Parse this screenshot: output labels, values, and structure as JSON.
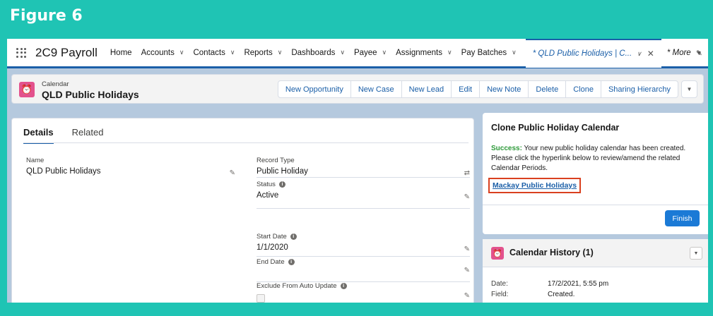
{
  "figure": {
    "title": "Figure 6"
  },
  "nav": {
    "app_name": "2C9 Payroll",
    "items": [
      {
        "label": "Home",
        "has_menu": false
      },
      {
        "label": "Accounts",
        "has_menu": true
      },
      {
        "label": "Contacts",
        "has_menu": true
      },
      {
        "label": "Reports",
        "has_menu": true
      },
      {
        "label": "Dashboards",
        "has_menu": true
      },
      {
        "label": "Payee",
        "has_menu": true
      },
      {
        "label": "Assignments",
        "has_menu": true
      },
      {
        "label": "Pay Batches",
        "has_menu": true
      }
    ],
    "active_tab": "* QLD Public Holidays | C...",
    "more": "* More"
  },
  "header": {
    "object_type": "Calendar",
    "record_name": "QLD Public Holidays",
    "buttons": [
      "New Opportunity",
      "New Case",
      "New Lead",
      "Edit",
      "New Note",
      "Delete",
      "Clone",
      "Sharing Hierarchy"
    ]
  },
  "details": {
    "tabs": {
      "details": "Details",
      "related": "Related"
    },
    "name": {
      "label": "Name",
      "value": "QLD Public Holidays"
    },
    "record_type": {
      "label": "Record Type",
      "value": "Public Holiday"
    },
    "status": {
      "label": "Status",
      "value": "Active"
    },
    "start_date": {
      "label": "Start Date",
      "value": "1/1/2020"
    },
    "end_date": {
      "label": "End Date",
      "value": ""
    },
    "exclude": {
      "label": "Exclude From Auto Update",
      "checked": false
    }
  },
  "clone": {
    "title": "Clone Public Holiday Calendar",
    "success_label": "Success:",
    "message": " Your new public holiday calendar has been created. Please click the hyperlink below to review/amend the related Calendar Periods.",
    "link": "Mackay Public Holidays",
    "finish": "Finish"
  },
  "history": {
    "title": "Calendar History (1)",
    "date_label": "Date:",
    "date_value": "17/2/2021, 5:55 pm",
    "field_label": "Field:",
    "field_value": "Created."
  },
  "colors": {
    "frame_bg": "#1fc4b4",
    "brand_blue": "#1b5fa8",
    "calendar_icon": "#e3528d",
    "success_green": "#2e9a3a",
    "highlight_red": "#d9401f"
  },
  "icons": {
    "app_launcher": "waffle-icon",
    "calendar": "calendar-icon",
    "edit": "pencil-icon",
    "info": "info-icon",
    "dropdown": "chevron-down-icon",
    "close": "close-icon"
  }
}
